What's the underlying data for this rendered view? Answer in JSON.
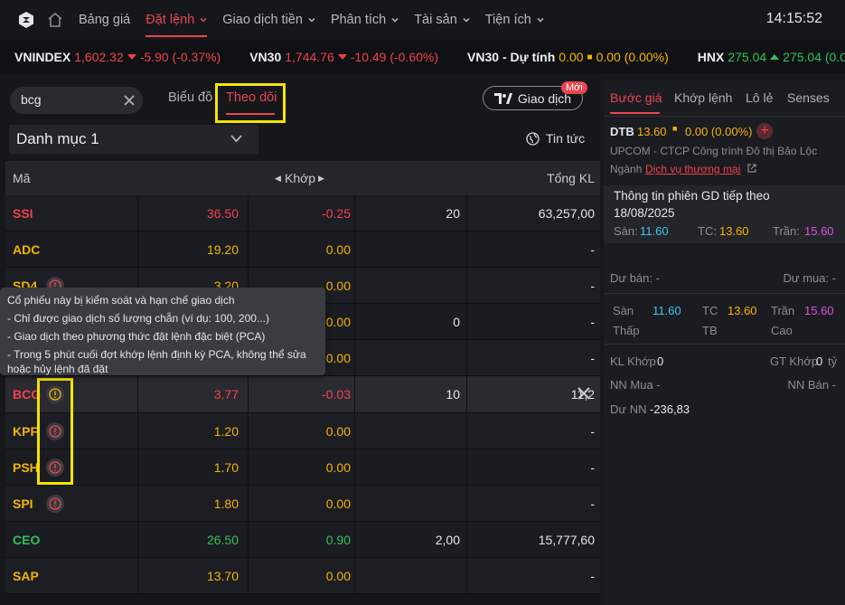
{
  "nav": {
    "items": [
      {
        "label": "Bảng giá",
        "active": false,
        "caret": false
      },
      {
        "label": "Đặt lệnh",
        "active": true,
        "caret": true
      },
      {
        "label": "Giao dịch tiền",
        "active": false,
        "caret": true
      },
      {
        "label": "Phân tích",
        "active": false,
        "caret": true
      },
      {
        "label": "Tài sản",
        "active": false,
        "caret": true
      },
      {
        "label": "Tiện ích",
        "active": false,
        "caret": true
      }
    ],
    "time": "14:15:52"
  },
  "ticker": [
    {
      "name": "VNINDEX",
      "value": "1,602.32",
      "change": "-5.90 (-0.37%)",
      "dir": "down"
    },
    {
      "name": "VN30",
      "value": "1,744.76",
      "change": "-10.49 (-0.60%)",
      "dir": "down"
    },
    {
      "name": "VN30 - Dự tính",
      "value": "0.00",
      "change": "0.00 (0.00%)",
      "dir": "flat"
    },
    {
      "name": "HNX",
      "value": "275.04",
      "change": "275.04 (0.00%",
      "dir": "up"
    }
  ],
  "left": {
    "search_value": "bcg",
    "tab_chart": "Biểu đồ",
    "tab_watch": "Theo dõi",
    "trade_button": "Giao dịch",
    "new_badge": "Mới",
    "portfolio": "Danh mục 1",
    "news": "Tin tức",
    "headers": {
      "symbol": "Mã",
      "match": "Khớp",
      "total": "Tổng KL"
    },
    "rows": [
      {
        "symbol": "SSI",
        "price": "36.50",
        "change": "-0.25",
        "vol": "20",
        "total": "63,257,00",
        "color": "red",
        "warn": false
      },
      {
        "symbol": "ADC",
        "price": "19.20",
        "change": "0.00",
        "vol": "",
        "total": "-",
        "color": "yellow",
        "warn": false
      },
      {
        "symbol": "SD4",
        "price": "3.20",
        "change": "0.00",
        "vol": "",
        "total": "-",
        "color": "yellow",
        "warn": true
      },
      {
        "symbol": "",
        "price": "",
        "change": "0.00",
        "vol": "0",
        "total": "-",
        "color": "yellow",
        "warn": false
      },
      {
        "symbol": "",
        "price": "",
        "change": "0.00",
        "vol": "",
        "total": "-",
        "color": "yellow",
        "warn": false
      },
      {
        "symbol": "BCG",
        "price": "3.77",
        "change": "-0.03",
        "vol": "10",
        "total": "11,2",
        "color": "red",
        "warn": true,
        "hover": true
      },
      {
        "symbol": "KPF",
        "price": "1.20",
        "change": "0.00",
        "vol": "",
        "total": "-",
        "color": "yellow",
        "warn": true
      },
      {
        "symbol": "PSH",
        "price": "1.70",
        "change": "0.00",
        "vol": "",
        "total": "-",
        "color": "yellow",
        "warn": true
      },
      {
        "symbol": "SPI",
        "price": "1.80",
        "change": "0.00",
        "vol": "",
        "total": "-",
        "color": "yellow",
        "warn": true
      },
      {
        "symbol": "CEO",
        "price": "26.50",
        "change": "0.90",
        "vol": "2,00",
        "total": "15,777,60",
        "color": "green",
        "warn": false
      },
      {
        "symbol": "SAP",
        "price": "13.70",
        "change": "0.00",
        "vol": "",
        "total": "-",
        "color": "yellow",
        "warn": false
      }
    ],
    "tooltip": {
      "title": "Cổ phiếu này bị kiểm soát và hạn chế giao dịch",
      "line1": "- Chỉ được giao dịch số lượng chẵn (ví dụ: 100, 200...)",
      "line2": "- Giao dịch theo phương thức đặt lệnh đặc biệt (PCA)",
      "line3a": "- Trong 5 phút cuối đợt khớp lệnh định kỳ PCA, không thể sửa",
      "line3b": "hoặc hủy lệnh đã đặt"
    }
  },
  "right": {
    "tabs": [
      "Bước giá",
      "Khớp lệnh",
      "Lô lẻ",
      "Senses"
    ],
    "symbol": "DTB",
    "price": "13.60",
    "change": "0.00 (0.00%)",
    "company": "UPCOM - CTCP Công trình Đô thị Bảo Lộc",
    "sector_label": "Ngành",
    "sector": "Dịch vụ thương mại",
    "session_title": "Thông tin phiên GD tiếp theo",
    "session_date": "18/08/2025",
    "san_label": "Sàn:",
    "san": "11.60",
    "tc_label": "TC:",
    "tc": "13.60",
    "tran_label": "Trần:",
    "tran": "15.60",
    "du_ban": "Dư bán: -",
    "du_mua": "Dư mua: -",
    "san2_label": "Sàn",
    "san2": "11.60",
    "tc2_label": "TC",
    "tc2": "13.60",
    "tran2_label": "Trần",
    "tran2": "15.60",
    "thap": "Thấp",
    "tb": "TB",
    "cao": "Cao",
    "kl_khop_label": "KL Khớp",
    "kl_khop": "0",
    "gt_khop_label": "GT Khớp",
    "gt_khop": "0",
    "gt_unit": "tỷ",
    "nn_mua": "NN Mua -",
    "nn_ban": "NN Bán -",
    "du_nn_label": "Dư NN",
    "du_nn": "-236,83"
  },
  "colors": {
    "accent": "#e8464f",
    "up": "#2fc25b",
    "down": "#f0414c",
    "ref": "#f5b400",
    "floor": "#3ec6f0",
    "ceil": "#e050e0",
    "highlight": "#f5e400"
  }
}
